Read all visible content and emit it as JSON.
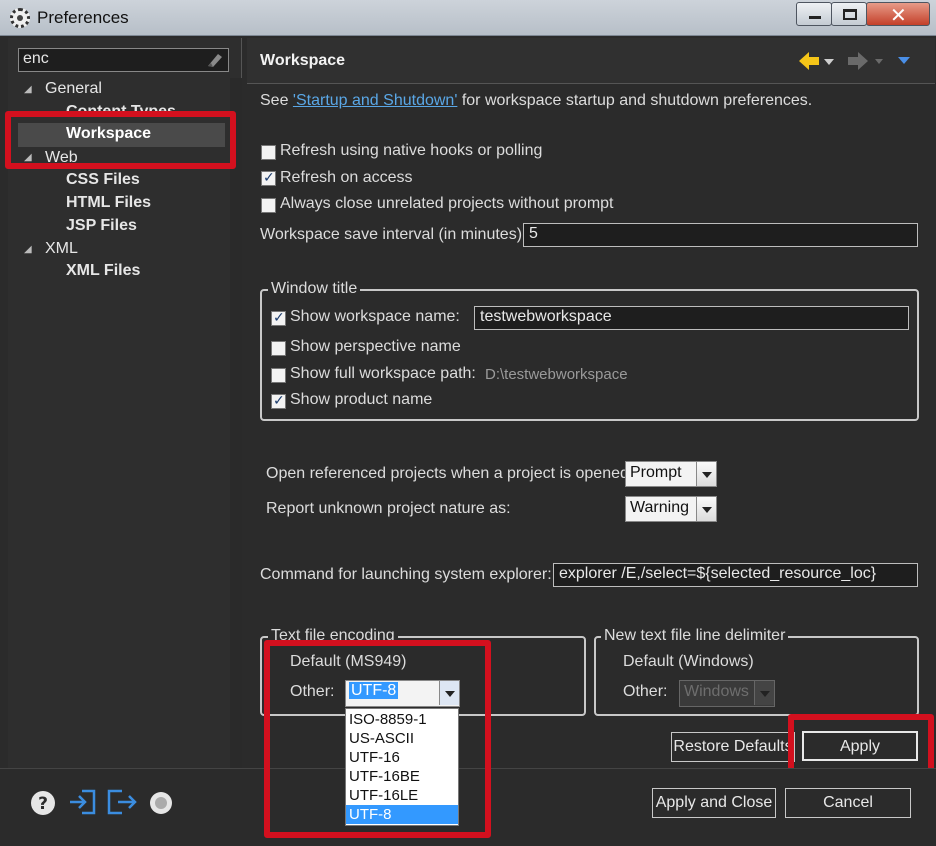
{
  "window": {
    "title": "Preferences",
    "min": "minimize",
    "max": "maximize",
    "close": "✕"
  },
  "filter": {
    "value": "enc"
  },
  "tree": {
    "general": "General",
    "content_types": "Content Types",
    "workspace": "Workspace",
    "web": "Web",
    "css": "CSS Files",
    "html": "HTML Files",
    "jsp": "JSP Files",
    "xml": "XML",
    "xml_files": "XML Files"
  },
  "page": {
    "title": "Workspace",
    "intro_prefix": "See ",
    "intro_link": "'Startup and Shutdown'",
    "intro_suffix": " for workspace startup and shutdown preferences.",
    "refresh_native": {
      "label": "Refresh using native hooks or polling",
      "checked": false
    },
    "refresh_access": {
      "label": "Refresh on access",
      "checked": true
    },
    "always_close": {
      "label": "Always close unrelated projects without prompt",
      "checked": false
    },
    "save_interval": {
      "label": "Workspace save interval (in minutes):",
      "value": "5"
    },
    "window_title_group": {
      "title": "Window title",
      "show_ws_name": {
        "label": "Show workspace name:",
        "checked": true,
        "value": "testwebworkspace"
      },
      "show_persp": {
        "label": "Show perspective name",
        "checked": false
      },
      "show_path": {
        "label": "Show full workspace path:",
        "checked": false,
        "value": "D:\\testwebworkspace"
      },
      "show_product": {
        "label": "Show product name",
        "checked": true
      }
    },
    "open_ref": {
      "label": "Open referenced projects when a project is opened:",
      "value": "Prompt"
    },
    "report_nature": {
      "label": "Report unknown project nature as:",
      "value": "Warning"
    },
    "explorer_cmd": {
      "label": "Command for launching system explorer:",
      "value": "explorer /E,/select=${selected_resource_loc}"
    },
    "encoding_group": {
      "title": "Text file encoding",
      "default_label": "Default (MS949)",
      "other_label": "Other:",
      "other_value": "UTF-8",
      "options": [
        "ISO-8859-1",
        "US-ASCII",
        "UTF-16",
        "UTF-16BE",
        "UTF-16LE",
        "UTF-8"
      ],
      "selected_index": 5
    },
    "delimiter_group": {
      "title": "New text file line delimiter",
      "default_label": "Default (Windows)",
      "other_label": "Other:",
      "other_value": "Windows"
    },
    "restore_defaults": "Restore Defaults",
    "apply": "Apply"
  },
  "footer": {
    "apply_close": "Apply and Close",
    "cancel": "Cancel"
  },
  "colors": {
    "highlight": "#d3101e",
    "selection": "#3399ff",
    "nav_back": "#f5c518"
  }
}
